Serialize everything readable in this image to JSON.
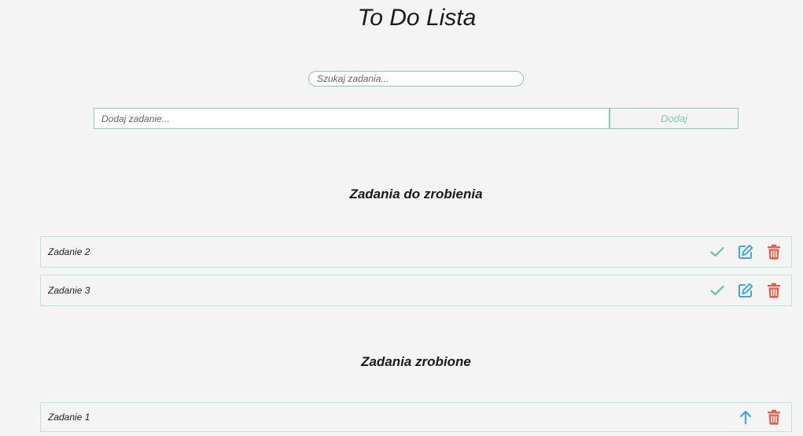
{
  "app": {
    "title": "To Do Lista"
  },
  "search": {
    "placeholder": "Szukaj zadania..."
  },
  "add": {
    "placeholder": "Dodaj zadanie...",
    "button_label": "Dodaj"
  },
  "sections": {
    "todo": {
      "title": "Zadania do zrobienia",
      "tasks": [
        {
          "label": "Zadanie 2",
          "actions": [
            "check-icon",
            "edit-icon",
            "trash-icon"
          ]
        },
        {
          "label": "Zadanie 3",
          "actions": [
            "check-icon",
            "edit-icon",
            "trash-icon"
          ]
        }
      ]
    },
    "done": {
      "title": "Zadania zrobione",
      "tasks": [
        {
          "label": "Zadanie 1",
          "actions": [
            "arrow-up-icon",
            "trash-icon"
          ]
        }
      ]
    }
  },
  "colors": {
    "accent": "#7dcca9",
    "border": "#86cdb0",
    "check": "#5cc4a0",
    "edit": "#3fa7e0",
    "delete": "#e0604f",
    "background": "#f4f4f4"
  }
}
